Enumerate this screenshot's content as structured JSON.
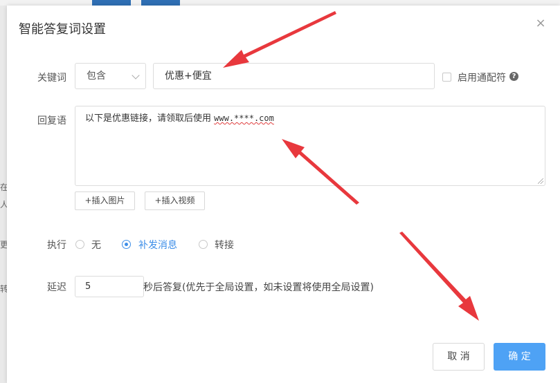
{
  "dialog": {
    "title": "智能答复词设置",
    "close_glyph": "×"
  },
  "keyword": {
    "label": "关键词",
    "match_mode": "包含",
    "value": "优惠+便宜",
    "wildcard_label": "启用通配符",
    "wildcard_checked": false,
    "help_glyph": "?"
  },
  "reply": {
    "label": "回复语",
    "text": "以下是优惠链接，请领取后使用 ",
    "url": "www.****.com",
    "insert_image_label": "+插入图片",
    "insert_video_label": "+插入视频"
  },
  "execute": {
    "label": "执行",
    "options": [
      "无",
      "补发消息",
      "转接"
    ],
    "selected": "补发消息"
  },
  "delay": {
    "label": "延迟",
    "value": "5",
    "suffix": "秒后答复(优先于全局设置，如未设置将使用全局设置)"
  },
  "footer": {
    "cancel_label": "取 消",
    "confirm_label": "确 定"
  },
  "background": {
    "side_chars": [
      "在",
      "人",
      "更",
      "转"
    ]
  },
  "colors": {
    "accent": "#3d8ee8",
    "primary_button": "#4ea2f5",
    "annotation_arrow": "#e8383d"
  }
}
